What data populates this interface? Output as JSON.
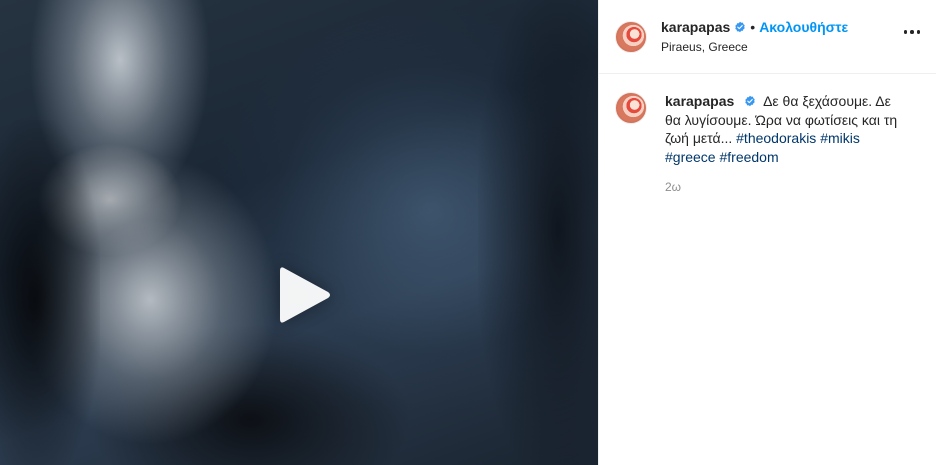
{
  "post": {
    "username": "karapapas",
    "follow_label": "Ακολουθήστε",
    "separator": "•",
    "location": "Piraeus, Greece",
    "caption": {
      "username": "karapapas",
      "text": "Δε θα ξεχάσουμε. Δε θα λυγίσουμε. Ώρα να φωτίσεις και τη ζωή μετά... ",
      "hashtags": [
        "#theodorakis",
        "#mikis",
        "#greece",
        "#freedom"
      ]
    },
    "time_ago": "2ω"
  },
  "icons": {
    "play": "play-icon",
    "verified": "verified-badge-icon",
    "more": "more-options-icon"
  },
  "colors": {
    "link_blue": "#0095f6",
    "hashtag": "#00376b",
    "muted": "#8e8e8e",
    "verified": "#3897f0"
  }
}
